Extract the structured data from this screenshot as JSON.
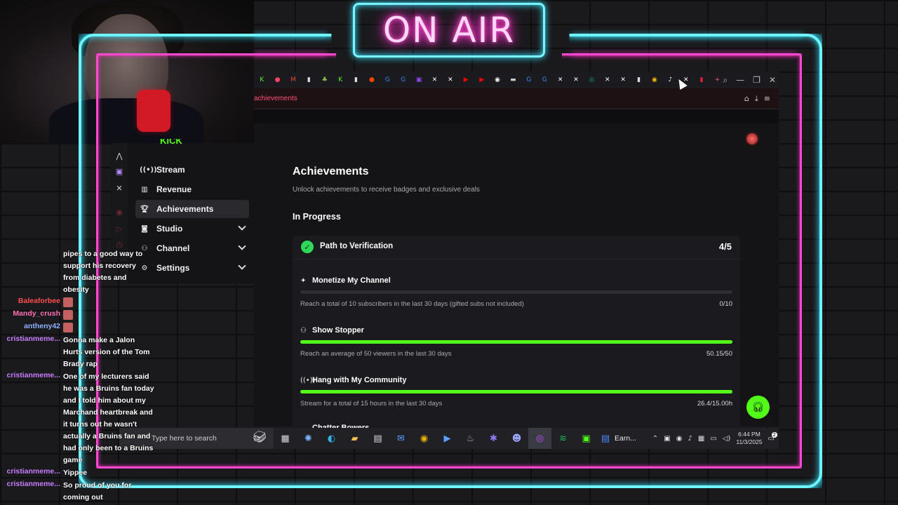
{
  "overlay": {
    "on_air_text": "ON AIR",
    "colors": {
      "neon_cyan": "#6ff3ff",
      "neon_pink": "#ff49d1",
      "accent_green": "#53fc18"
    }
  },
  "browser": {
    "url_fragment": "achievements",
    "tab_icons": [
      "kick-icon",
      "bell-icon",
      "gmail-icon",
      "doc-icon",
      "leaf-icon",
      "kick-icon",
      "doc-icon",
      "reddit-icon",
      "google-icon",
      "google-icon",
      "twitch-icon",
      "x-icon",
      "x-icon",
      "youtube-icon",
      "youtube-icon",
      "github-icon",
      "dots-icon",
      "google-icon",
      "google-icon",
      "x-icon",
      "x-icon",
      "chat-icon",
      "x-icon",
      "x-icon",
      "doc-icon",
      "chrome-icon",
      "tiktok-icon",
      "x-icon",
      "active-tab-icon",
      "new-tab-icon"
    ]
  },
  "sidebar": {
    "logo": "KICK",
    "items": [
      {
        "label": "Stream",
        "icon": "broadcast-icon",
        "expandable": false
      },
      {
        "label": "Revenue",
        "icon": "chart-icon",
        "expandable": false
      },
      {
        "label": "Achievements",
        "icon": "trophy-icon",
        "expandable": false,
        "active": true
      },
      {
        "label": "Studio",
        "icon": "studio-icon",
        "expandable": true
      },
      {
        "label": "Channel",
        "icon": "users-icon",
        "expandable": true
      },
      {
        "label": "Settings",
        "icon": "gear-icon",
        "expandable": true
      }
    ]
  },
  "main": {
    "title": "Achievements",
    "subtitle": "Unlock achievements to receive badges and exclusive deals",
    "section": "In Progress",
    "card": {
      "title": "Path to Verification",
      "count": "4/5",
      "tasks": [
        {
          "name": "Monetize My Channel",
          "icon": "sparkle-icon",
          "desc": "Reach a total of 10 subscribers in the last 30 days (gifted subs not included)",
          "progress": "0/10",
          "fraction": 0
        },
        {
          "name": "Show Stopper",
          "icon": "viewers-icon",
          "desc": "Reach an average of 50 viewers in the last 30 days",
          "progress": "50.15/50",
          "fraction": 1
        },
        {
          "name": "Hang with My Community",
          "icon": "broadcast-icon",
          "desc": "Stream for a total of 15 hours in the last 30 days",
          "progress": "26.4/15.00h",
          "fraction": 1
        }
      ],
      "cut_off_task": "Chatter Bowers"
    }
  },
  "taskbar": {
    "search_placeholder": "Type here to search",
    "running_app_label": "Earn...",
    "time": "6:44 PM",
    "date": "11/3/2025",
    "notification_count": "2"
  },
  "chat": [
    {
      "user": "",
      "color": "#ffffff",
      "lines": [
        "pipes to a good way to",
        "support his recovery",
        "from diabetes and",
        "obesity"
      ]
    },
    {
      "user": "Baleaforbee",
      "color": "#ff4d4d",
      "lines": [
        ""
      ]
    },
    {
      "user": "Mandy_crush",
      "color": "#ff6fb0",
      "lines": [
        ""
      ]
    },
    {
      "user": "antheny42",
      "color": "#8fb0ff",
      "lines": [
        ""
      ]
    },
    {
      "user": "cristianmeme...",
      "color": "#c77dff",
      "lines": [
        "Gonna make a Jalon",
        "Hurts version of the Tom",
        "Brady rap"
      ]
    },
    {
      "user": "cristianmeme...",
      "color": "#c77dff",
      "lines": [
        "One of my lecturers said",
        "he was a Bruins fan today",
        "and I told him about my",
        "Marchand heartbreak and",
        "it turns out he wasn't",
        "actually a Bruins fan and",
        "had only been to a Bruins",
        "game"
      ]
    },
    {
      "user": "cristianmeme...",
      "color": "#c77dff",
      "lines": [
        "Yippee"
      ]
    },
    {
      "user": "cristianmeme...",
      "color": "#c77dff",
      "lines": [
        "So proud of you for",
        "coming out"
      ]
    }
  ]
}
